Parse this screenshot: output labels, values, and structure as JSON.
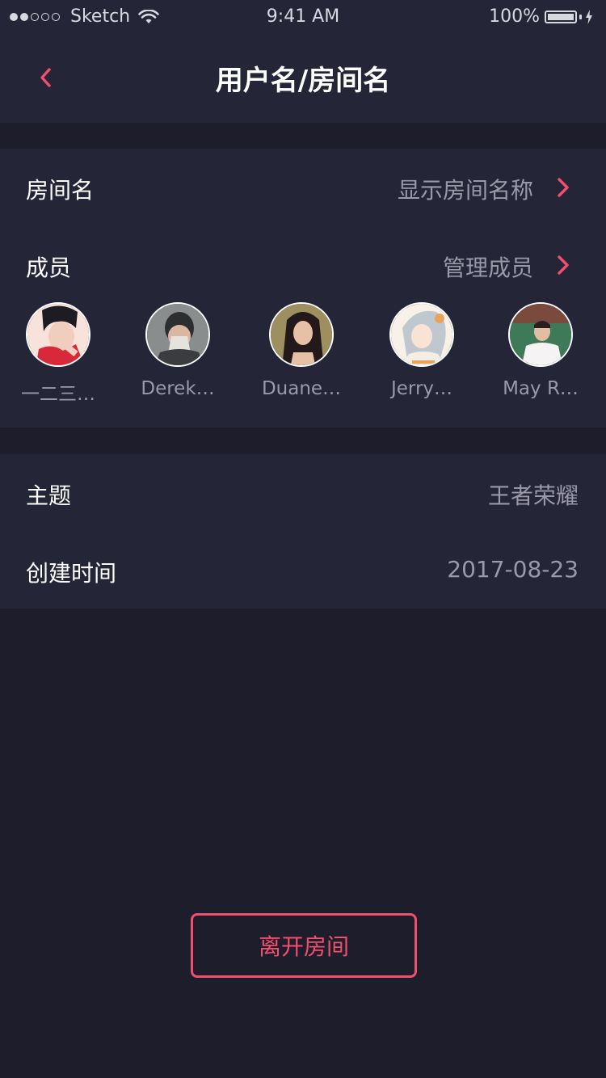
{
  "status_bar": {
    "carrier": "Sketch",
    "time": "9:41 AM",
    "battery": "100%"
  },
  "nav": {
    "title": "用户名/房间名",
    "back_icon": "chevron-left-icon"
  },
  "room_name_row": {
    "label": "房间名",
    "value": "显示房间名称"
  },
  "members_row": {
    "label": "成员",
    "value": "管理成员"
  },
  "members": [
    {
      "name": "一二三…",
      "avatar_colors": [
        "#f7e3da",
        "#d8283a",
        "#1c1c22"
      ]
    },
    {
      "name": "Derek…",
      "avatar_colors": [
        "#8a8d8e",
        "#e6e2dc",
        "#2d2e30"
      ]
    },
    {
      "name": "Duane…",
      "avatar_colors": [
        "#9d8f5f",
        "#e7c0a6",
        "#23191a"
      ]
    },
    {
      "name": "Jerry…",
      "avatar_colors": [
        "#f8f1e8",
        "#bfc8cf",
        "#e9a25a"
      ]
    },
    {
      "name": "May R…",
      "avatar_colors": [
        "#3e7a57",
        "#f5f3f3",
        "#7a4a3d"
      ]
    }
  ],
  "theme_row": {
    "label": "主题",
    "value": "王者荣耀"
  },
  "created_row": {
    "label": "创建时间",
    "value": "2017-08-23"
  },
  "leave_button": {
    "label": "离开房间"
  },
  "colors": {
    "background": "#1e1d2c",
    "panel": "#252538",
    "accent": "#f04f6d",
    "secondary_text": "#9a99a8"
  }
}
